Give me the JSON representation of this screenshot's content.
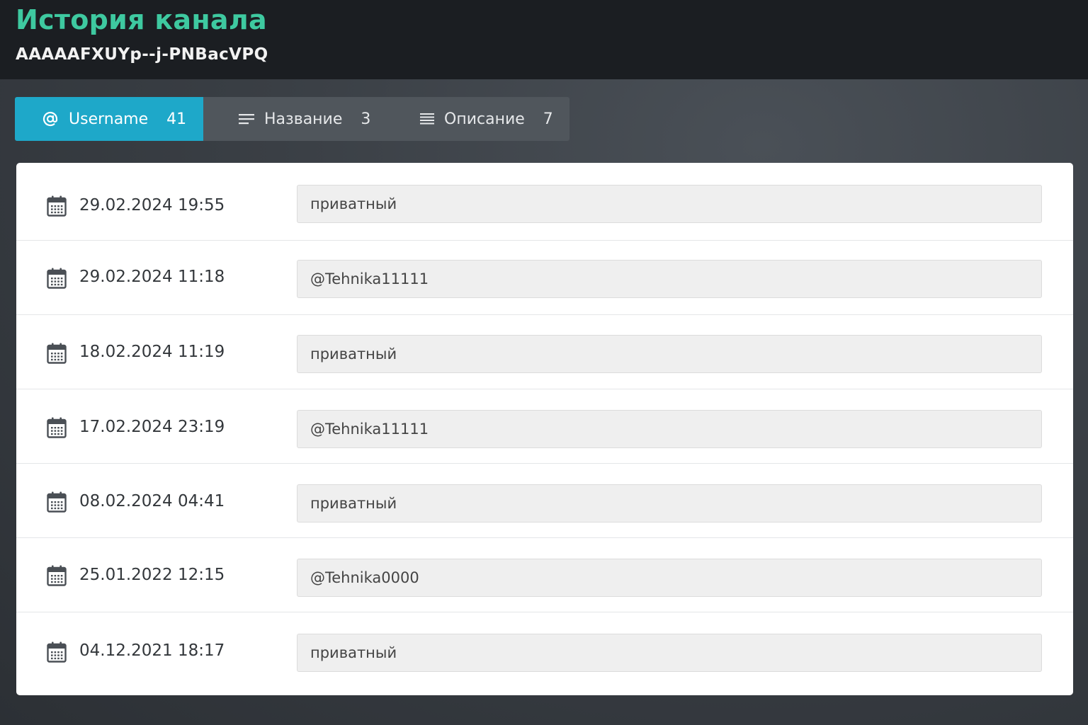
{
  "header": {
    "title": "История канала",
    "channel_id": "AAAAAFXUYp--j-PNBacVPQ"
  },
  "tabs": [
    {
      "label": "Username",
      "count": "41",
      "icon": "at-icon",
      "active": true
    },
    {
      "label": "Название",
      "count": "3",
      "icon": "lines-icon",
      "active": false
    },
    {
      "label": "Описание",
      "count": "7",
      "icon": "text-lines-icon",
      "active": false
    }
  ],
  "history": [
    {
      "date": "29.02.2024 19:55",
      "value": "приватный"
    },
    {
      "date": "29.02.2024 11:18",
      "value": "@Tehnika11111"
    },
    {
      "date": "18.02.2024 11:19",
      "value": "приватный"
    },
    {
      "date": "17.02.2024 23:19",
      "value": "@Tehnika11111"
    },
    {
      "date": "08.02.2024 04:41",
      "value": "приватный"
    },
    {
      "date": "25.01.2022 12:15",
      "value": "@Tehnika0000"
    },
    {
      "date": "04.12.2021 18:17",
      "value": "приватный"
    }
  ],
  "colors": {
    "accent": "#3ec9a0",
    "active_tab": "#1ea8c9",
    "header_bg": "#1b1e22"
  }
}
